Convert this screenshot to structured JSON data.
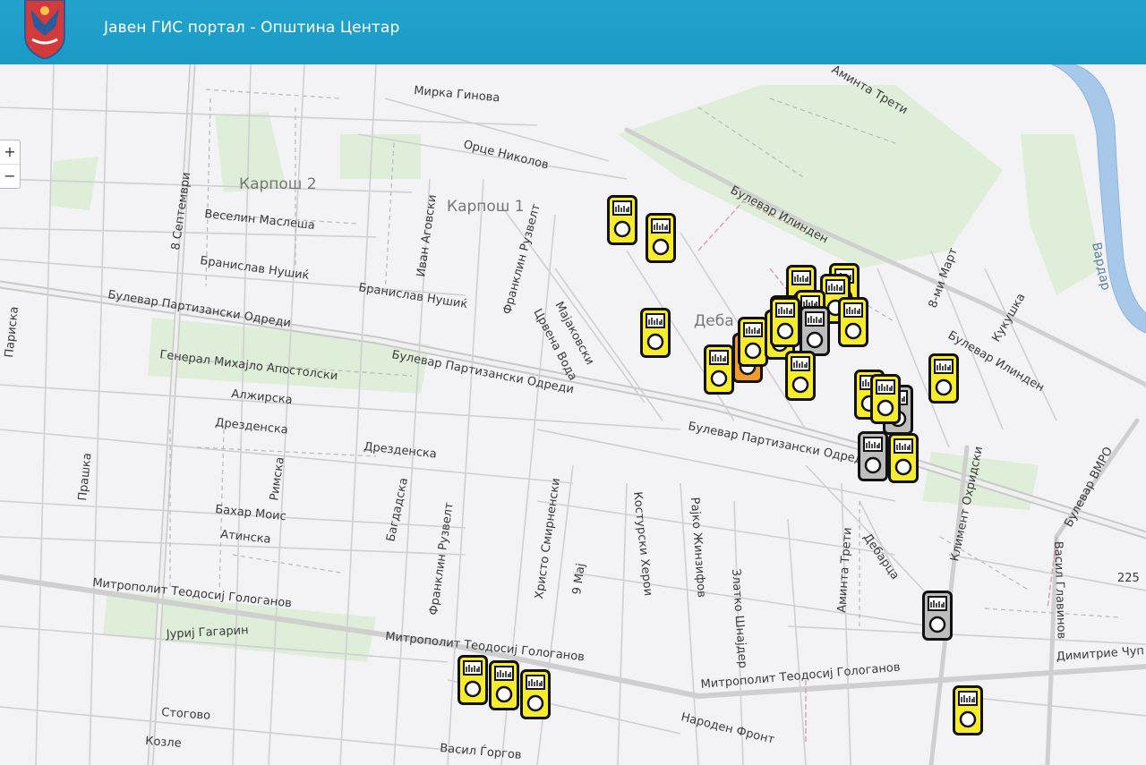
{
  "header": {
    "title": "Јавен ГИС портал - Општина Центар"
  },
  "zoom": {
    "in_label": "+",
    "out_label": "−"
  },
  "districts": {
    "karpos2": "Карпош 2",
    "karpos1": "Карпош 1",
    "debar": "Деба"
  },
  "river": "Вардар",
  "streets": {
    "mirka": "Мирка Гинова",
    "orce": "Орце Николов",
    "vesel": "Веселин Маслеша",
    "bran1": "Бранислав Нушиќ",
    "bran2": "Бранислав Нушиќ",
    "sept": "8 Септември",
    "ivan": "Иван Аговски",
    "frank1": "Франклин Рузвелт",
    "majak": "Мајаковски",
    "crvena": "Црвена Вода",
    "bp1": "Булевар Партизански Одреди",
    "bp2": "Булевар Партизански Одреди",
    "bp3": "Булевар Партизански Одред",
    "general": "Генерал Михајло Апостолски",
    "alzir": "Алжирска",
    "drez1": "Дрезденска",
    "drez2": "Дрезденска",
    "praska": "Прашка",
    "rimska": "Римска",
    "bagd": "Багдадска",
    "bahar": "Бахар Моис",
    "atin": "Атинска",
    "frank2": "Франклин Рузвелт",
    "hristo": "Христо Смирненски",
    "maj9": "9 Мај",
    "kost": "Костурски Херои",
    "rajko": "Рајко Жинзифов",
    "zlatko": "Златко Шнајдер",
    "aminta1": "Аминта Трети",
    "aminta2": "Аминта Трети",
    "debarca": "Дебарца",
    "kliment": "Климент Охридски",
    "bil1": "Булевар Илинден",
    "bil2": "Булевар Илинден",
    "mart": "8-ми Март",
    "kukus": "Кукушка",
    "vmro": "Булевар ВМРО",
    "vasilg": "Васил Главинов",
    "mitr1": "Митрополит Теодосиј Гологанов",
    "mitr2": "Митрополит Теодосиј Гологанов",
    "mitr3": "Митрополит Теодосиј Гологанов",
    "jurij": "Јуриј Гагарин",
    "stogo": "Стогово",
    "kozle": "Козле",
    "vasil": "Васил Ѓоргов",
    "narod": "Народен Фронт",
    "dimitrie": "Димитрие Чуп",
    "pariska": "Париска",
    "num225": "225"
  },
  "marker_colors": {
    "yellow": "#f7ec2a",
    "gray": "#bdbdbd",
    "orange": "#f39a2b"
  },
  "markers": [
    {
      "color": "orange"
    },
    {
      "color": "yellow"
    },
    {
      "color": "yellow"
    },
    {
      "color": "yellow"
    },
    {
      "color": "yellow"
    },
    {
      "color": "yellow"
    },
    {
      "color": "yellow"
    },
    {
      "color": "yellow"
    },
    {
      "color": "yellow"
    },
    {
      "color": "yellow"
    },
    {
      "color": "yellow"
    },
    {
      "color": "yellow"
    },
    {
      "color": "gray"
    },
    {
      "color": "yellow"
    },
    {
      "color": "yellow"
    },
    {
      "color": "yellow"
    },
    {
      "color": "yellow"
    },
    {
      "color": "gray"
    },
    {
      "color": "yellow"
    },
    {
      "color": "gray"
    },
    {
      "color": "yellow"
    },
    {
      "color": "gray"
    },
    {
      "color": "yellow"
    },
    {
      "color": "yellow"
    },
    {
      "color": "yellow"
    },
    {
      "color": "yellow"
    },
    {
      "color": "yellow"
    }
  ]
}
